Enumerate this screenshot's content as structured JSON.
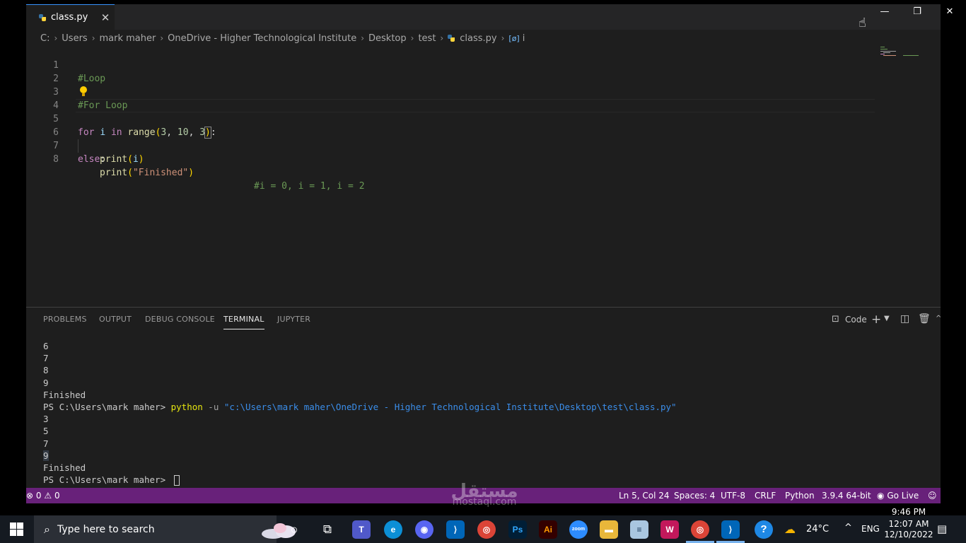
{
  "editor": {
    "tab": {
      "filename": "class.py",
      "close": "✕"
    },
    "breadcrumb": [
      "C:",
      "Users",
      "mark maher",
      "OneDrive - Higher Technological Institute",
      "Desktop",
      "test",
      "class.py",
      "i"
    ],
    "breadcrumb_symbol": "[ø]",
    "line_numbers": [
      "1",
      "2",
      "3",
      "4",
      "5",
      "6",
      "7",
      "8"
    ],
    "code": {
      "l1": "#Loop",
      "l3": "#For Loop",
      "l5": {
        "kw_for": "for",
        "var_i": "i",
        "kw_in": "in",
        "fn_range": "range",
        "open": "(",
        "n1": "3",
        "c1": ", ",
        "n2": "10",
        "c2": ", ",
        "n3": "3",
        "close": ")",
        "colon": ":"
      },
      "l6": {
        "fn": "print",
        "open": "(",
        "arg": "i",
        "close": ")"
      },
      "l7": {
        "kw": "else",
        "colon": ":"
      },
      "l8": {
        "fn": "print",
        "open": "(",
        "str": "\"Finished\"",
        "close": ")",
        "comment": "#i = 0, i = 1, i = 2"
      }
    }
  },
  "panel": {
    "tabs": [
      "PROBLEMS",
      "OUTPUT",
      "DEBUG CONSOLE",
      "TERMINAL",
      "JUPYTER"
    ],
    "active_tab": "TERMINAL",
    "shell_label": "Code",
    "terminal": {
      "lines_before": [
        "6",
        "7",
        "8",
        "9",
        "Finished"
      ],
      "prompt": "PS C:\\Users\\mark maher> ",
      "cmd": "python",
      "flag": " -u ",
      "path": "\"c:\\Users\\mark maher\\OneDrive - Higher Technological Institute\\Desktop\\test\\class.py\"",
      "lines_after": [
        "3",
        "5",
        "7",
        "9",
        "Finished"
      ],
      "final_prompt": "PS C:\\Users\\mark maher> "
    }
  },
  "statusbar": {
    "errors": "0",
    "warnings": "0",
    "position": "Ln 5, Col 24",
    "spaces": "Spaces: 4",
    "encoding": "UTF-8",
    "eol": "CRLF",
    "language": "Python",
    "interpreter": "3.9.4 64-bit",
    "golive": "Go Live"
  },
  "window": {
    "minimize": "—",
    "maximize": "❐",
    "close": "✕"
  },
  "watermark": {
    "arabic": "مستقل",
    "latin": "mostaql.com"
  },
  "taskbar": {
    "search_placeholder": "Type here to search",
    "weather": "24°C",
    "language": "ENG",
    "time": "9:46 PM",
    "time2": "12:07 AM",
    "date": "12/10/2022",
    "icons": [
      "teams",
      "edge",
      "discord",
      "vscode",
      "chrome",
      "photoshop",
      "illustrator",
      "zoom",
      "file-explorer",
      "notepad",
      "app-pink",
      "chrome-profile",
      "vscode-2",
      "help"
    ]
  }
}
